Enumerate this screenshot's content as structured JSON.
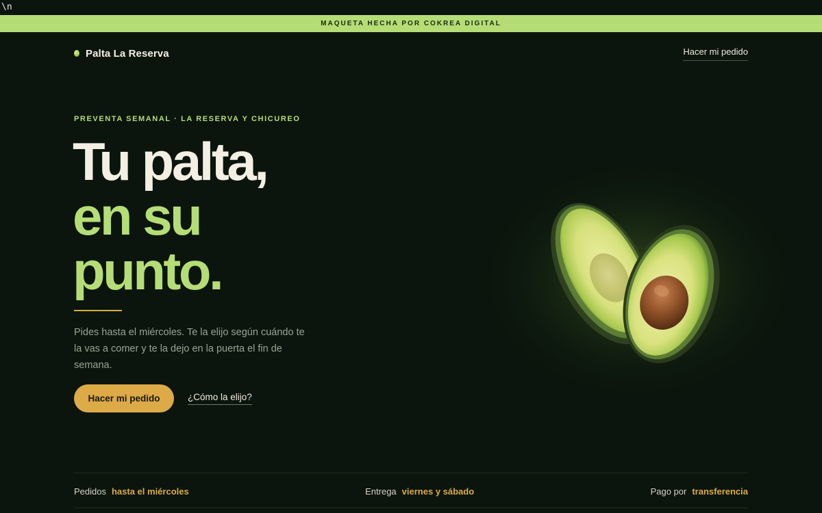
{
  "stray_text": "\\n",
  "banner": {
    "text": "MAQUETA HECHA POR COKREA DIGITAL"
  },
  "nav": {
    "brand_name": "Palta La Reserva",
    "cta_label": "Hacer mi pedido"
  },
  "hero": {
    "eyebrow": "PREVENTA SEMANAL · LA RESERVA Y CHICUREO",
    "headline_line1": "Tu palta,",
    "headline_line2": "en su",
    "headline_line3": "punto.",
    "lead": "Pides hasta el miércoles. Te la elijo según cuándo te la vas a comer y te la dejo en la puerta el fin de semana.",
    "primary_button": "Hacer mi pedido",
    "secondary_link": "¿Cómo la elijo?",
    "image_icon": "avocado-halves-icon"
  },
  "info": [
    {
      "label": "Pedidos",
      "value": "hasta el miércoles"
    },
    {
      "label": "Entrega",
      "value": "viernes y sábado"
    },
    {
      "label": "Pago por",
      "value": "transferencia"
    }
  ],
  "colors": {
    "background": "#0b150d",
    "accent_green": "#b5dd76",
    "accent_gold": "#dcab47",
    "text_light": "#f3efe2",
    "text_muted": "#98a593"
  }
}
